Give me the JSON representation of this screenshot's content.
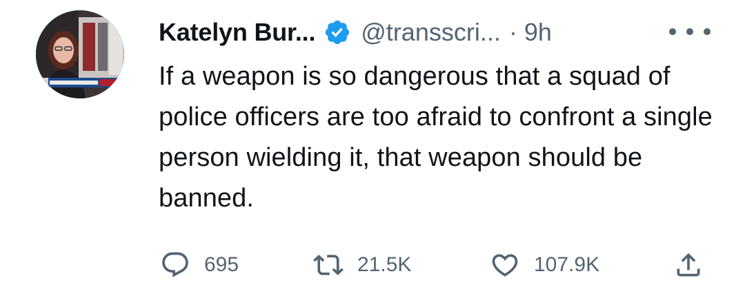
{
  "tweet": {
    "author_name": "Katelyn Bur...",
    "handle": "@transscri...",
    "separator": "·",
    "time": "9h",
    "text": "If a weapon is so dangerous that a squad of police officers are too afraid to confront a single person wielding it, that weapon should be banned.",
    "counts": {
      "replies": "695",
      "retweets": "21.5K",
      "likes": "107.9K"
    }
  },
  "icons": {
    "verified": "verified-badge-icon",
    "more": "more-options-icon",
    "reply": "reply-icon",
    "retweet": "retweet-icon",
    "like": "heart-icon",
    "share": "share-icon"
  },
  "colors": {
    "verified": "#1d9bf0",
    "text": "#0f1419",
    "muted": "#536471"
  }
}
